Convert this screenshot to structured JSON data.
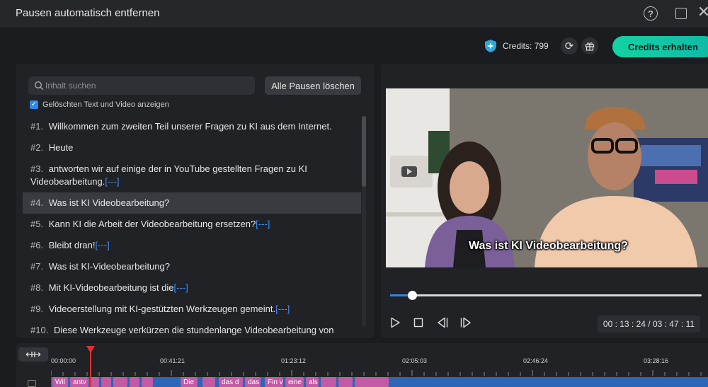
{
  "window": {
    "title": "Pausen automatisch entfernen",
    "help_glyph": "?",
    "close_glyph": "✕"
  },
  "credits": {
    "label": "Credits: 799",
    "get_button": "Credits erhalten",
    "refresh_glyph": "⟳"
  },
  "search": {
    "placeholder": "Inhalt suchen"
  },
  "clear_button": "Alle Pausen löschen",
  "show_deleted": {
    "label": "Gelöschten Text und Video anzeigen",
    "checked": true,
    "check_glyph": "✓"
  },
  "transcript": [
    {
      "num": "#1.",
      "text": "Willkommen zum zweiten Teil unserer Fragen zu KI aus dem Internet.",
      "pause": ""
    },
    {
      "num": "#2.",
      "text": "Heute",
      "pause": ""
    },
    {
      "num": "#3.",
      "text": "antworten wir auf einige der in YouTube gestellten Fragen zu KI Videobearbeitung.",
      "pause": "[---]"
    },
    {
      "num": "#4.",
      "text": "Was ist KI Videobearbeitung?",
      "pause": ""
    },
    {
      "num": "#5.",
      "text": "Kann KI die Arbeit der Videobearbeitung ersetzen?",
      "pause": "[---]"
    },
    {
      "num": "#6.",
      "text": "Bleibt dran!",
      "pause": "[---]"
    },
    {
      "num": "#7.",
      "text": "Was ist KI-Videobearbeitung?",
      "pause": ""
    },
    {
      "num": "#8.",
      "text": "Mit KI-Videobearbeitung ist die",
      "pause": "[---]"
    },
    {
      "num": "#9.",
      "text": "Videoerstellung mit KI-gestützten Werkzeugen gemeint.",
      "pause": "[---]"
    },
    {
      "num": "#10.",
      "text": "Diese Werkzeuge verkürzen die stundenlange Videobearbeitung von Hand",
      "pause": ""
    }
  ],
  "selected_index": 3,
  "video": {
    "subtitle": "Was ist KI Videobearbeitung?",
    "progress": 0.07
  },
  "player": {
    "time": "00 : 13 : 24 / 03 : 47 : 11"
  },
  "timeline": {
    "ruler": [
      "00:00:00",
      "00:41:21",
      "01:23:12",
      "02:05:03",
      "02:46:24",
      "03:28:16"
    ],
    "clips": [
      "Wil",
      "antv",
      "",
      "",
      "",
      "",
      "",
      "Die",
      "",
      "das d",
      "das",
      "Fin v",
      "eine",
      "als",
      "",
      "",
      ""
    ]
  },
  "colors": {
    "accent": "#2f86e8",
    "credits_button": "#13d3a4",
    "pause_marker": "#3f8ef0",
    "playhead": "#e03131",
    "clip": "#c25aa6",
    "track": "#2c66b8"
  }
}
